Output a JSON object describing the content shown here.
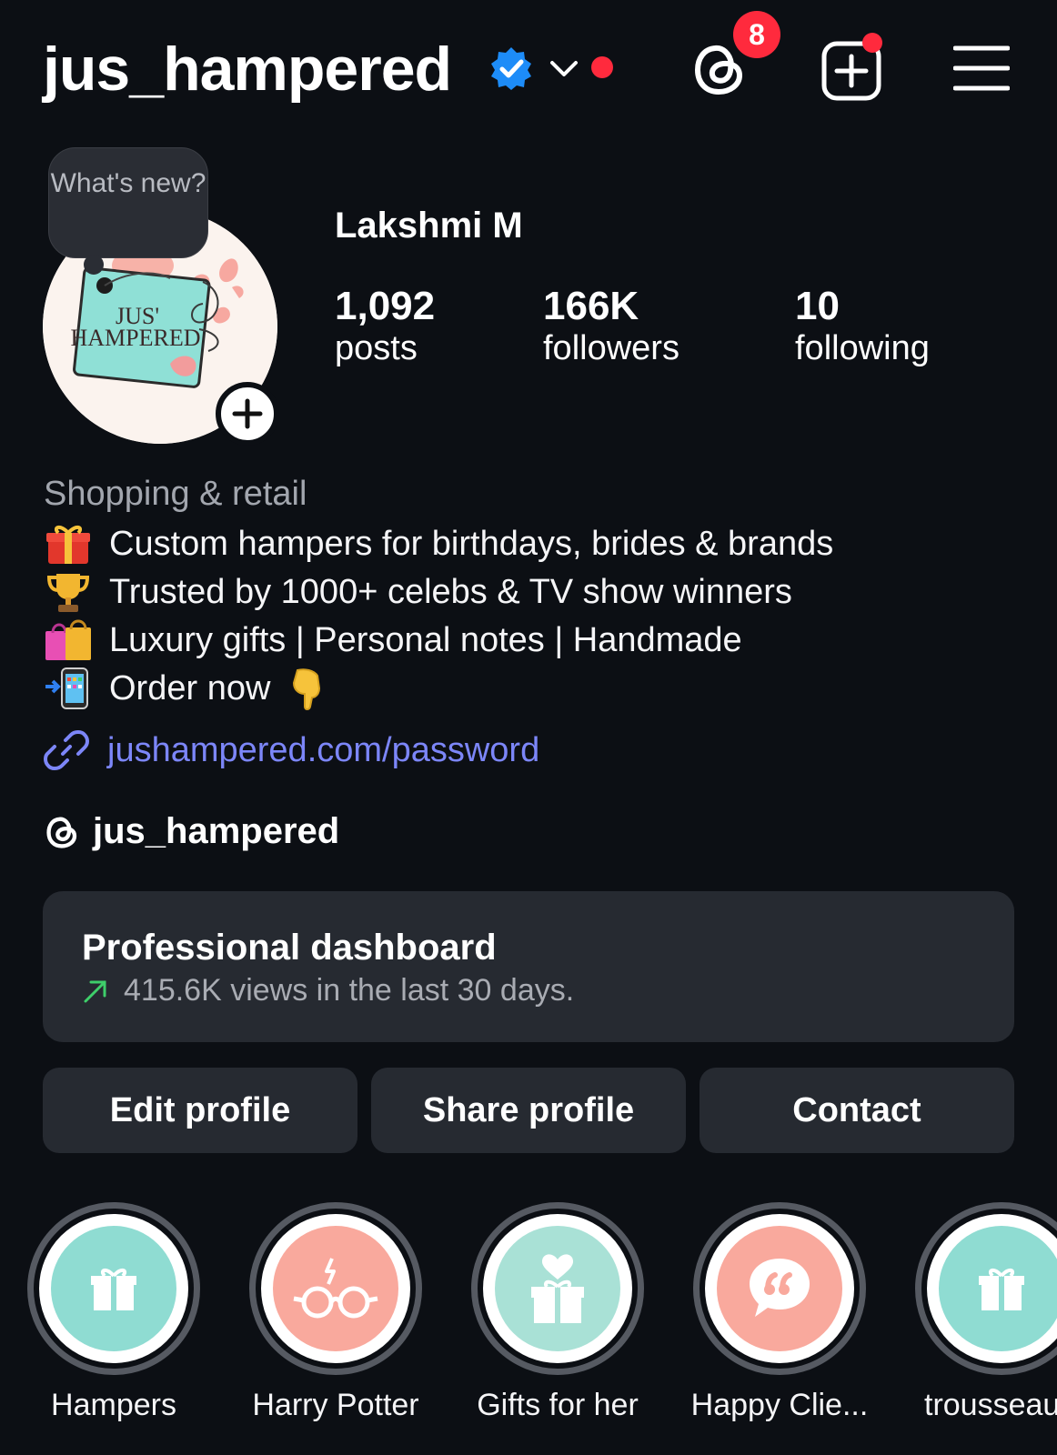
{
  "header": {
    "username": "jus_hampered",
    "threads_badge_count": "8"
  },
  "profile": {
    "note_text": "What's new?",
    "logo_text_line1": "JUS'",
    "logo_text_line2": "HAMPERED",
    "display_name": "Lakshmi M",
    "stats": [
      {
        "value": "1,092",
        "label": "posts"
      },
      {
        "value": "166K",
        "label": "followers"
      },
      {
        "value": "10",
        "label": "following"
      }
    ],
    "category": "Shopping & retail",
    "bio": [
      {
        "icon": "gift-emoji",
        "text": "Custom hampers for birthdays, brides & brands"
      },
      {
        "icon": "trophy-emoji",
        "text": "Trusted by 1000+ celebs & TV show winners"
      },
      {
        "icon": "shopping-bags-emoji",
        "text": "Luxury gifts | Personal notes | Handmade"
      },
      {
        "icon": "phone-arrow-emoji",
        "text": "Order now"
      }
    ],
    "link": "jushampered.com/password",
    "threads_handle": "jus_hampered"
  },
  "dashboard": {
    "title": "Professional dashboard",
    "subtitle": "415.6K views in the last 30 days.",
    "trend_color": "#3ecf6a"
  },
  "actions": {
    "edit": "Edit profile",
    "share": "Share profile",
    "contact": "Contact"
  },
  "highlights": [
    {
      "label": "Hampers",
      "icon": "gift-icon",
      "color": "#8fdcd2"
    },
    {
      "label": "Harry Potter",
      "icon": "glasses-icon",
      "color": "#f9a99d"
    },
    {
      "label": "Gifts for her",
      "icon": "heart-gift-icon",
      "color": "#a9e1d6"
    },
    {
      "label": "Happy Clie...",
      "icon": "quote-bubble-icon",
      "color": "#f9a99d"
    },
    {
      "label": "trousseau",
      "icon": "gift-icon",
      "color": "#8fdcd2"
    }
  ],
  "colors": {
    "background": "#0c0f14",
    "card": "#262a31",
    "link": "#7c86f8",
    "verified": "#1d8cf8",
    "notification": "#ff2a3d"
  }
}
